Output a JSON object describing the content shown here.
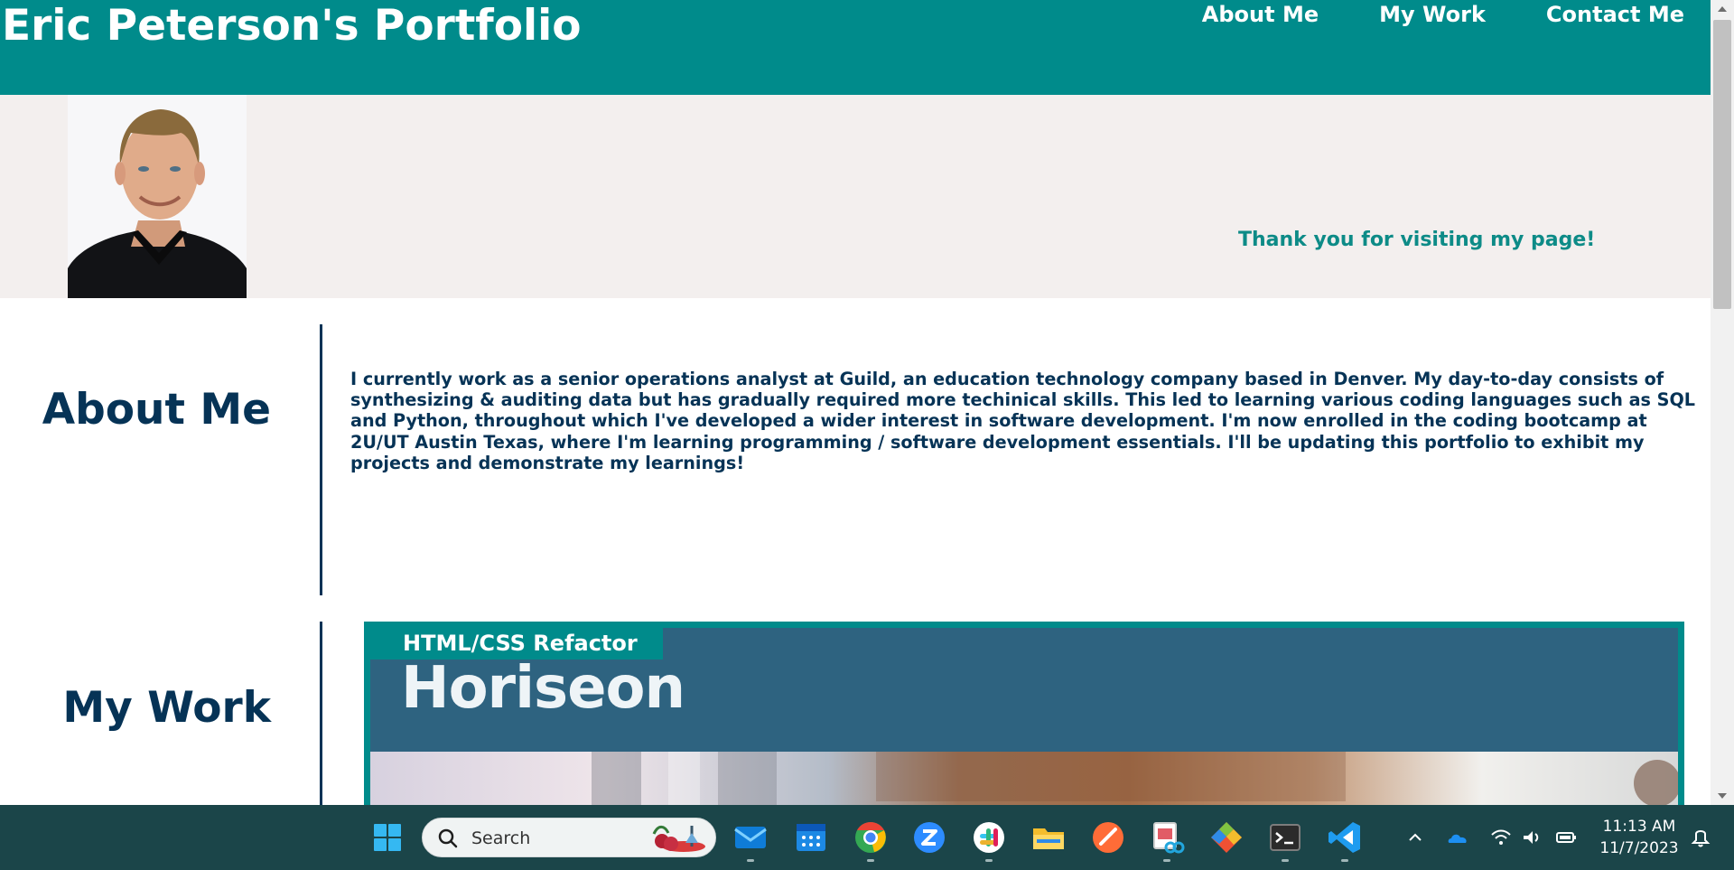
{
  "header": {
    "title": "Eric Peterson's Portfolio",
    "nav": [
      "About Me",
      "My Work",
      "Contact Me"
    ]
  },
  "hero": {
    "thanks": "Thank you for visiting my page!"
  },
  "about": {
    "title": "About Me",
    "text": "I currently work as a senior operations analyst at Guild, an education technology company based in Denver. My day-to-day consists of synthesizing & auditing data but has gradually required more techinical skills. This led to learning various coding languages such as SQL and Python, throughout which I've developed a wider interest in software development. I'm now enrolled in the coding bootcamp at 2U/UT Austin Texas, where I'm learning programming / software development essentials. I'll be updating this portfolio to exhibit my projects and demonstrate my learnings!"
  },
  "work": {
    "title": "My Work",
    "project": {
      "label": "HTML/CSS Refactor",
      "brand": "Horiseon"
    }
  },
  "taskbar": {
    "search_label": "Search",
    "time": "11:13 AM",
    "date": "11/7/2023",
    "apps": [
      "start-icon",
      "mail-icon",
      "calendar-icon",
      "chrome-icon",
      "zoom-icon",
      "slack-icon",
      "file-explorer-icon",
      "postman-icon",
      "snipping-tool-icon",
      "git-icon",
      "terminal-icon",
      "vscode-icon"
    ]
  },
  "colors": {
    "header_bg": "#008b8b",
    "hero_bg": "#f3efee",
    "heading_text": "#063356",
    "project_bg": "#2e6380",
    "taskbar_bg": "#1b4549"
  }
}
